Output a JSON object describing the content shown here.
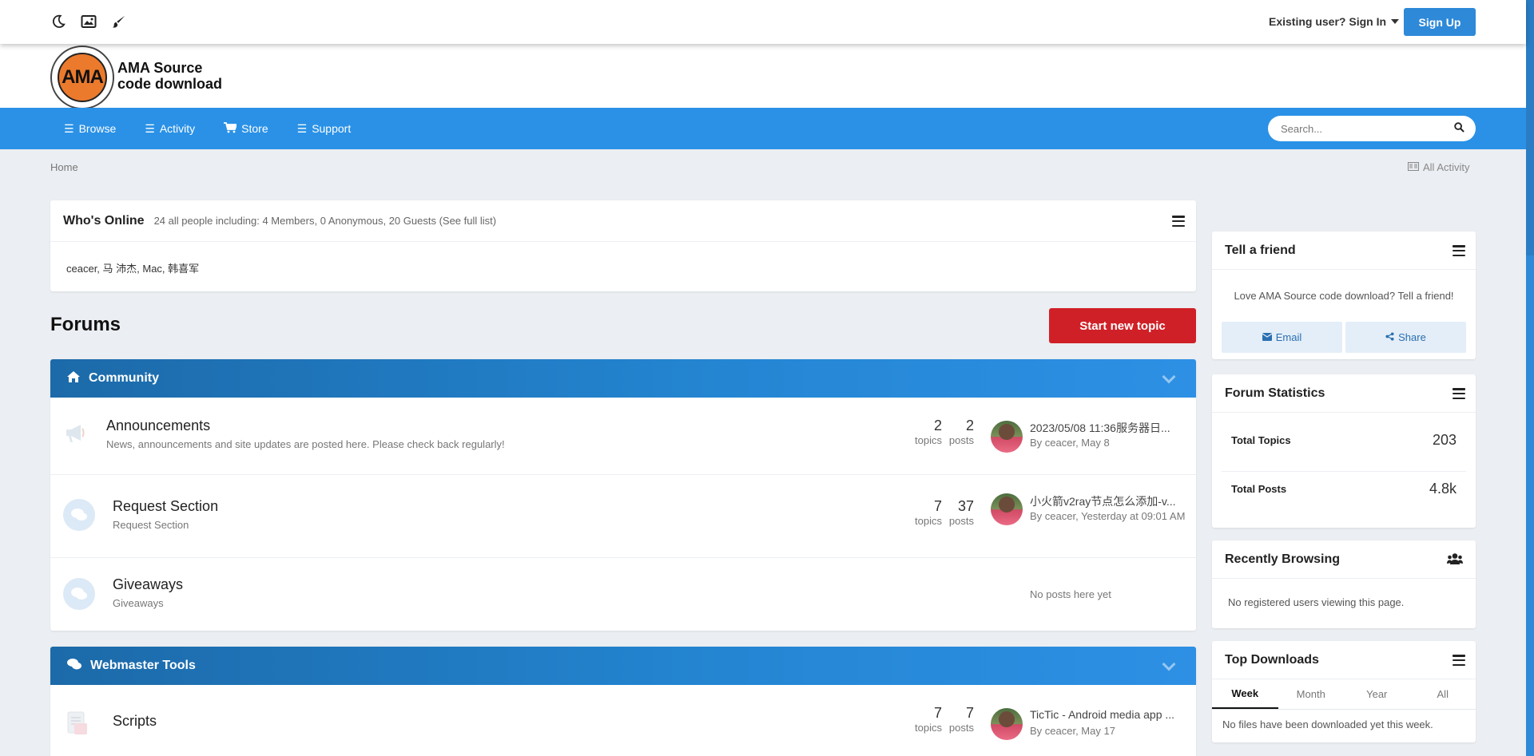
{
  "header": {
    "icons": [
      "moon-icon",
      "image-icon",
      "brush-icon"
    ],
    "signin_label": "Existing user? Sign In",
    "signup_label": "Sign Up"
  },
  "logo": {
    "badge_text": "AMA",
    "title_line1": "AMA Source",
    "title_line2": "code download"
  },
  "nav": {
    "items": [
      {
        "label": "Browse",
        "icon": "menu-icon"
      },
      {
        "label": "Activity",
        "icon": "menu-icon"
      },
      {
        "label": "Store",
        "icon": "cart-icon"
      },
      {
        "label": "Support",
        "icon": "menu-icon"
      }
    ],
    "search_placeholder": "Search..."
  },
  "breadcrumb": {
    "home": "Home",
    "all_activity": "All Activity"
  },
  "whos_online": {
    "title": "Who's Online",
    "summary": "24 all people including: 4 Members, 0 Anonymous, 20 Guests (See full list)",
    "members": "ceacer, 马 沛杰, Mac, 韩喜军"
  },
  "forums": {
    "title": "Forums",
    "start_topic_label": "Start new topic",
    "categories": [
      {
        "name": "Community",
        "icon": "home-icon",
        "rows": [
          {
            "title": "Announcements",
            "desc": "News, announcements and site updates are posted here. Please check back regularly!",
            "topics": "2",
            "topics_label": "topics",
            "posts": "2",
            "posts_label": "posts",
            "last_title": "2023/05/08 11:36服务器日...",
            "last_by": "By ceacer, May 8"
          },
          {
            "title": "Request Section",
            "desc": "Request Section",
            "topics": "7",
            "topics_label": "topics",
            "posts": "37",
            "posts_label": "posts",
            "last_title": "小火箭v2ray节点怎么添加-v...",
            "last_by": "By ceacer, Yesterday at 09:01 AM"
          },
          {
            "title": "Giveaways",
            "desc": "Giveaways",
            "no_posts": "No posts here yet"
          }
        ]
      },
      {
        "name": "Webmaster Tools",
        "icon": "comments-icon",
        "rows": [
          {
            "title": "Scripts",
            "topics": "7",
            "topics_label": "topics",
            "posts": "7",
            "posts_label": "posts",
            "last_title": "TicTic - Android media app ...",
            "last_by": "By ceacer, May 17"
          }
        ]
      }
    ]
  },
  "sidebar": {
    "tell_friend": {
      "title": "Tell a friend",
      "text": "Love AMA Source code download? Tell a friend!",
      "email_label": "Email",
      "share_label": "Share"
    },
    "stats": {
      "title": "Forum Statistics",
      "topics_label": "Total Topics",
      "topics_value": "203",
      "posts_label": "Total Posts",
      "posts_value": "4.8k"
    },
    "recent": {
      "title": "Recently Browsing",
      "text": "No registered users viewing this page."
    },
    "downloads": {
      "title": "Top Downloads",
      "tabs": [
        "Week",
        "Month",
        "Year",
        "All"
      ],
      "text": "No files have been downloaded yet this week."
    }
  }
}
